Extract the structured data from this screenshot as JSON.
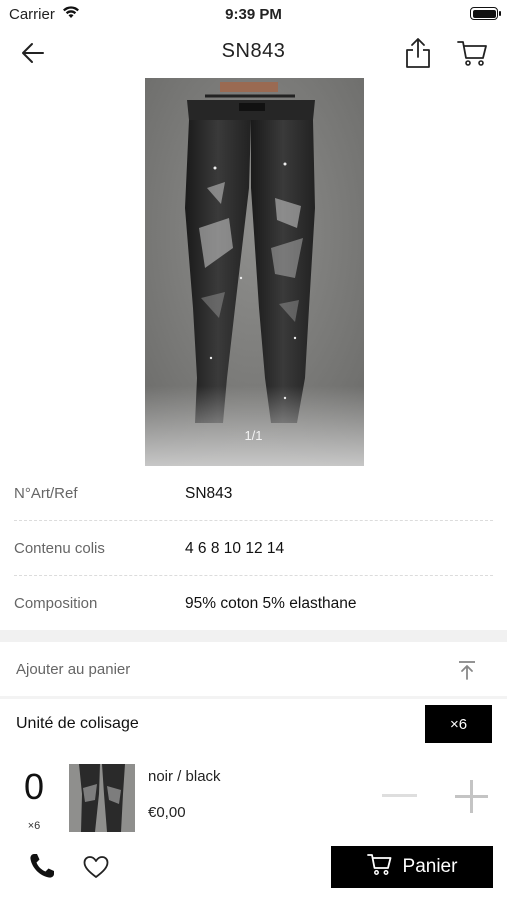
{
  "status_bar": {
    "carrier": "Carrier",
    "time": "9:39 PM"
  },
  "nav": {
    "title": "SN843",
    "icons": [
      "back-arrow-icon",
      "share-icon",
      "cart-icon"
    ]
  },
  "gallery": {
    "pager": "1/1",
    "image_subject": "black distressed skinny jeans on hanger"
  },
  "info": {
    "rows": [
      {
        "label": "N°Art/Ref",
        "value": "SN843"
      },
      {
        "label": "Contenu colis",
        "value": "4 6 8 10 12 14"
      },
      {
        "label": "Composition",
        "value": "95% coton 5% elasthane"
      }
    ]
  },
  "add_to_cart": {
    "label": "Ajouter au panier"
  },
  "packing": {
    "label": "Unité de colisage",
    "button": "×6"
  },
  "variant": {
    "quantity": "0",
    "multiplier": "×6",
    "name": "noir / black",
    "price": "€0,00"
  },
  "bottom_bar": {
    "cart_button": "Panier"
  },
  "colors": {
    "accent": "#000000",
    "muted_text": "#666666",
    "divider": "#f1f1f1"
  }
}
